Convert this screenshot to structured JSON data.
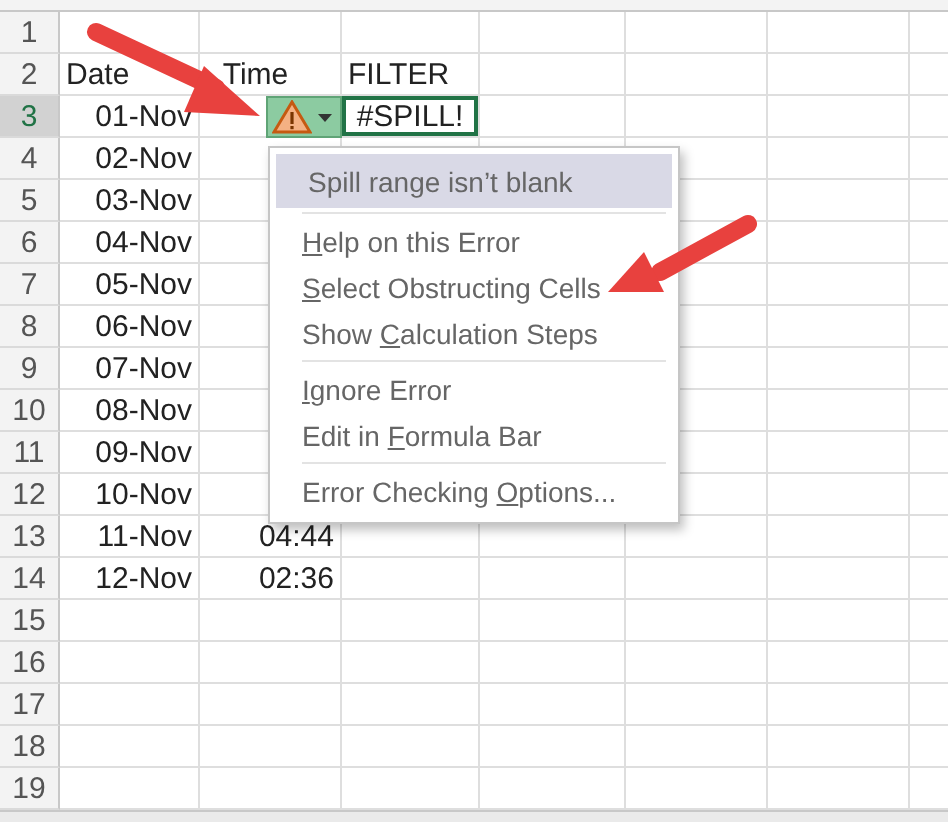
{
  "rows": [
    {
      "number": "1",
      "selected": false
    },
    {
      "number": "2",
      "date": "Date",
      "time": "Time",
      "filter": "FILTER",
      "kind": "header",
      "selected": false
    },
    {
      "number": "3",
      "date": "01-Nov",
      "filter": "#SPILL!",
      "error_button": true,
      "selected": true
    },
    {
      "number": "4",
      "date": "02-Nov",
      "selected": false
    },
    {
      "number": "5",
      "date": "03-Nov",
      "selected": false
    },
    {
      "number": "6",
      "date": "04-Nov",
      "selected": false
    },
    {
      "number": "7",
      "date": "05-Nov",
      "selected": false
    },
    {
      "number": "8",
      "date": "06-Nov",
      "selected": false
    },
    {
      "number": "9",
      "date": "07-Nov",
      "selected": false
    },
    {
      "number": "10",
      "date": "08-Nov",
      "selected": false
    },
    {
      "number": "11",
      "date": "09-Nov",
      "selected": false
    },
    {
      "number": "12",
      "date": "10-Nov",
      "selected": false
    },
    {
      "number": "13",
      "date": "11-Nov",
      "time": "04:44",
      "selected": false
    },
    {
      "number": "14",
      "date": "12-Nov",
      "time": "02:36",
      "selected": false
    },
    {
      "number": "15",
      "selected": false
    },
    {
      "number": "16",
      "selected": false
    },
    {
      "number": "17",
      "selected": false
    },
    {
      "number": "18",
      "selected": false
    },
    {
      "number": "19",
      "selected": false
    }
  ],
  "error_menu": {
    "title": "Spill range isn’t blank",
    "groups": [
      [
        {
          "key": "H",
          "after": "elp on this Error"
        },
        {
          "key": "S",
          "after": "elect Obstructing Cells"
        },
        {
          "before": "Show ",
          "key": "C",
          "after": "alculation Steps"
        }
      ],
      [
        {
          "key": "I",
          "after": "gnore Error"
        },
        {
          "before": "Edit in ",
          "key": "F",
          "after": "ormula Bar"
        }
      ],
      [
        {
          "before": "Error Checking ",
          "key": "O",
          "after": "ptions..."
        }
      ]
    ]
  },
  "annotations": [
    {
      "kind": "arrow"
    },
    {
      "kind": "arrow"
    }
  ]
}
